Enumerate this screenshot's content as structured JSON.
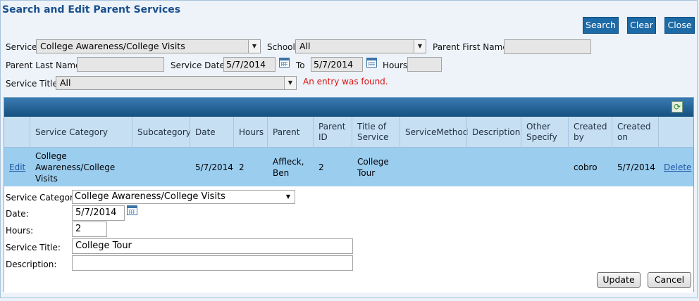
{
  "page": {
    "title": "Search and Edit Parent Services",
    "buttons": {
      "search": "Search",
      "clear": "Clear",
      "close": "Close"
    }
  },
  "filters": {
    "service_label": "Service",
    "service_value": "College Awareness/College Visits",
    "school_label": "School",
    "school_value": "All",
    "parent_first_label": "Parent First Name",
    "parent_first_value": "",
    "parent_last_label": "Parent Last Name",
    "parent_last_value": "",
    "service_date_label": "Service Date",
    "service_date_from": "5/7/2014",
    "to_label": "To",
    "service_date_to": "5/7/2014",
    "hours_label": "Hours",
    "hours_value": "",
    "service_title_label": "Service Title",
    "service_title_value": "All",
    "message": "An entry was found."
  },
  "grid": {
    "columns": [
      "Service Category",
      "Subcategory",
      "Date",
      "Hours",
      "Parent",
      "Parent ID",
      "Title of Service",
      "ServiceMethod",
      "Description",
      "Other Specify",
      "Created by",
      "Created on"
    ],
    "row": {
      "edit": "Edit",
      "service_category": "College Awareness/College Visits",
      "subcategory": "",
      "date": "5/7/2014",
      "hours": "2",
      "parent": "Affleck, Ben",
      "parent_id": "2",
      "title_of_service": "College Tour",
      "service_method": "",
      "description": "",
      "other_specify": "",
      "created_by": "cobro",
      "created_on": "5/7/2014",
      "delete": "Delete"
    }
  },
  "edit_form": {
    "service_category_label": "Service Category:",
    "service_category_value": "College Awareness/College Visits",
    "date_label": "Date:",
    "date_value": "5/7/2014",
    "hours_label": "Hours:",
    "hours_value": "2",
    "service_title_label": "Service Title:",
    "service_title_value": "College Tour",
    "description_label": "Description:",
    "description_value": "",
    "update": "Update",
    "cancel": "Cancel"
  },
  "icons": {
    "calendar": "calendar-icon",
    "refresh": "refresh-icon",
    "dropdown": "chevron-down-icon"
  },
  "colors": {
    "accent": "#1c6aa6",
    "error": "#dd1111",
    "selected_row": "#9bcdef"
  }
}
